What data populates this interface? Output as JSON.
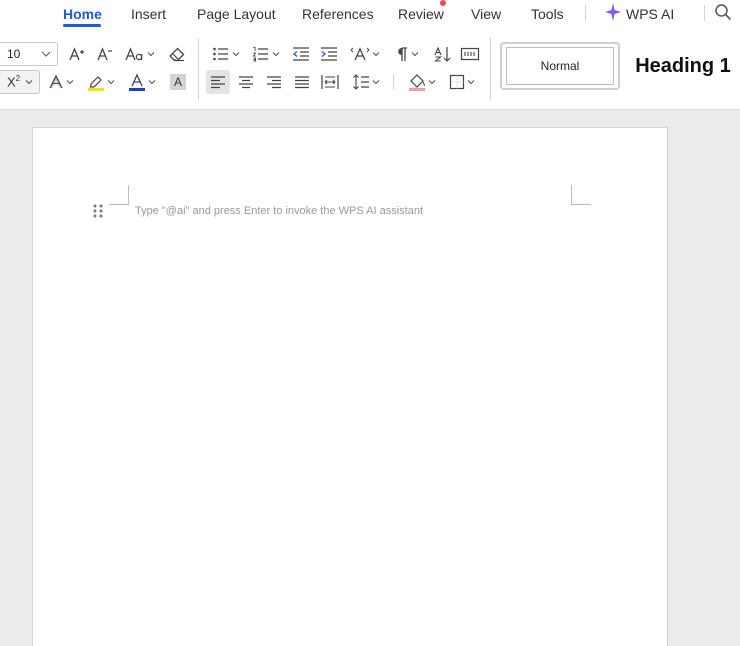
{
  "menu": {
    "tabs": [
      {
        "label": "Home",
        "active": true
      },
      {
        "label": "Insert"
      },
      {
        "label": "Page Layout"
      },
      {
        "label": "References"
      },
      {
        "label": "Review"
      },
      {
        "label": "View"
      },
      {
        "label": "Tools"
      }
    ],
    "wps_ai": "WPS AI",
    "accent": "#1e5bd8",
    "notification_color": "#e8504c"
  },
  "ribbon": {
    "font_size": "10",
    "clear_char_label": "A",
    "styles": {
      "normal": "Normal",
      "heading1": "Heading 1"
    },
    "highlight_color": "#f2e600",
    "font_color": "#1f3fbf"
  },
  "document": {
    "placeholder": "Type \"@ai\" and press Enter to invoke the WPS AI assistant"
  }
}
